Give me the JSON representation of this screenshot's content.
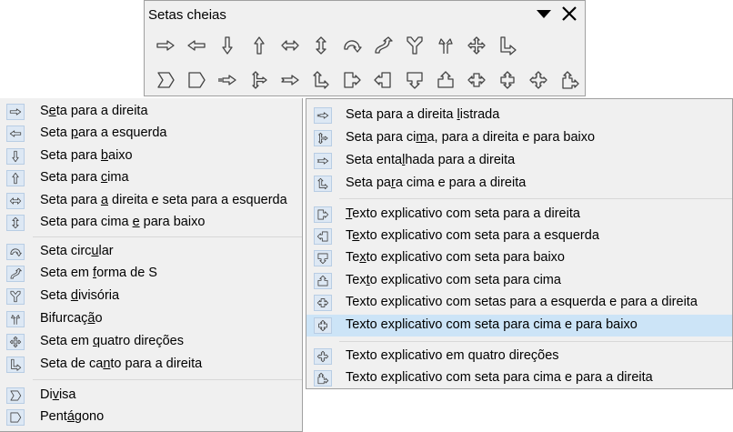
{
  "toolbar": {
    "title": "Setas cheias",
    "row1": [
      "arrow-right-icon",
      "arrow-left-icon",
      "arrow-down-icon",
      "arrow-up-icon",
      "arrow-left-right-icon",
      "arrow-up-down-icon",
      "circular-arrow-icon",
      "s-shaped-arrow-icon",
      "split-arrow-icon",
      "split-round-arrow-icon",
      "four-way-arrow-icon",
      "corner-right-arrow-icon"
    ],
    "row2": [
      "chevron-icon",
      "pentagon-icon",
      "striped-right-arrow-icon",
      "up-right-down-arrow-icon",
      "notched-right-arrow-icon",
      "up-right-arrow-icon",
      "right-callout-icon",
      "left-callout-icon",
      "down-callout-icon",
      "up-callout-icon",
      "left-right-callout-icon",
      "up-down-callout-icon",
      "four-way-callout-icon",
      "up-right-callout-icon"
    ]
  },
  "left_menu": {
    "items": [
      {
        "pre": "S",
        "u": "e",
        "post": "ta para a direita",
        "icon": "arrow-right-icon"
      },
      {
        "pre": "Seta ",
        "u": "p",
        "post": "ara a esquerda",
        "icon": "arrow-left-icon"
      },
      {
        "pre": "Seta para ",
        "u": "b",
        "post": "aixo",
        "icon": "arrow-down-icon"
      },
      {
        "pre": "Seta para ",
        "u": "c",
        "post": "ima",
        "icon": "arrow-up-icon"
      },
      {
        "pre": "Seta para ",
        "u": "a",
        "post": " direita e seta para a esquerda",
        "icon": "arrow-left-right-icon"
      },
      {
        "pre": "Seta para cima ",
        "u": "e",
        "post": " para baixo",
        "icon": "arrow-up-down-icon"
      },
      {
        "pre": "Seta circ",
        "u": "u",
        "post": "lar",
        "icon": "circular-arrow-icon"
      },
      {
        "pre": "Seta em ",
        "u": "f",
        "post": "orma de S",
        "icon": "s-shaped-arrow-icon"
      },
      {
        "pre": "Seta ",
        "u": "d",
        "post": "ivisória",
        "icon": "split-arrow-icon"
      },
      {
        "pre": "Bifurcaç",
        "u": "ã",
        "post": "o",
        "icon": "split-round-arrow-icon"
      },
      {
        "pre": "Seta em ",
        "u": "q",
        "post": "uatro direções",
        "icon": "four-way-arrow-icon"
      },
      {
        "pre": "Seta de ca",
        "u": "n",
        "post": "to para a direita",
        "icon": "corner-right-arrow-icon"
      },
      {
        "pre": "Di",
        "u": "v",
        "post": "isa",
        "icon": "chevron-icon"
      },
      {
        "pre": "Pent",
        "u": "á",
        "post": "gono",
        "icon": "pentagon-icon"
      }
    ]
  },
  "right_menu": {
    "items": [
      {
        "pre": "Seta para a direita ",
        "u": "l",
        "post": "istrada",
        "icon": "striped-right-arrow-icon"
      },
      {
        "pre": "Seta para ci",
        "u": "m",
        "post": "a, para a direita e para baixo",
        "icon": "up-right-down-arrow-icon"
      },
      {
        "pre": "Seta enta",
        "u": "l",
        "post": "hada para a direita",
        "icon": "notched-right-arrow-icon"
      },
      {
        "pre": "Seta pa",
        "u": "r",
        "post": "a cima e para a direita",
        "icon": "up-right-arrow-icon"
      },
      {
        "pre": "",
        "u": "T",
        "post": "exto explicativo com seta para a direita",
        "icon": "right-callout-icon"
      },
      {
        "pre": "T",
        "u": "e",
        "post": "xto explicativo com seta para a esquerda",
        "icon": "left-callout-icon"
      },
      {
        "pre": "Te",
        "u": "x",
        "post": "to explicativo com seta para baixo",
        "icon": "down-callout-icon"
      },
      {
        "pre": "Tex",
        "u": "t",
        "post": "o explicativo com seta para cima",
        "icon": "up-callout-icon"
      },
      {
        "pre": "Texto explicativo com setas para a esquerda e para a direita",
        "u": "",
        "post": "",
        "icon": "left-right-callout-icon"
      },
      {
        "pre": "Texto explicativo com seta para cima e para baixo",
        "u": "",
        "post": "",
        "icon": "up-down-callout-icon",
        "highlight": true
      },
      {
        "pre": "Texto explicativo em quatro direções",
        "u": "",
        "post": "",
        "icon": "four-way-callout-icon"
      },
      {
        "pre": "Texto explicativo com seta para cima e para a direita",
        "u": "",
        "post": "",
        "icon": "up-right-callout-icon"
      }
    ]
  }
}
